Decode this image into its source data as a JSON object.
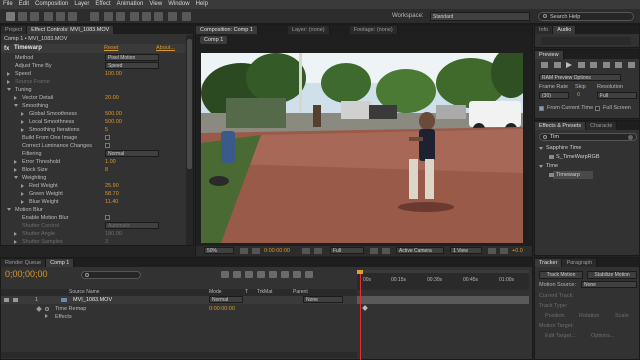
{
  "menu": [
    "File",
    "Edit",
    "Composition",
    "Layer",
    "Effect",
    "Animation",
    "View",
    "Window",
    "Help"
  ],
  "workspace": {
    "label": "Workspace:",
    "value": "Standard"
  },
  "search_help": {
    "placeholder": "Search Help"
  },
  "left_tabs": {
    "project": "Project",
    "effect_controls": "Effect Controls: MVI_1083.MOV"
  },
  "effect_controls": {
    "layer_path": "Comp 1 • MVI_1083.MOV",
    "effect_name": "Timewarp",
    "reset": "Reset",
    "about": "About...",
    "rows": [
      {
        "label": "Method",
        "value": "Pixel Motion",
        "kind": "dropdown"
      },
      {
        "label": "Adjust Time By",
        "value": "Speed",
        "kind": "dropdown"
      },
      {
        "label": "Speed",
        "value": "100.00",
        "kind": "value"
      },
      {
        "label": "Source Frame",
        "value": "",
        "kind": "dim"
      },
      {
        "label": "Tuning",
        "value": "",
        "kind": "group"
      },
      {
        "label": "Vector Detail",
        "value": "20.00",
        "kind": "value"
      },
      {
        "label": "Smoothing",
        "value": "",
        "kind": "group"
      },
      {
        "label": "Global Smoothness",
        "value": "500.00",
        "kind": "value"
      },
      {
        "label": "Local Smoothness",
        "value": "500.00",
        "kind": "value"
      },
      {
        "label": "Smoothing Iterations",
        "value": "5",
        "kind": "value"
      },
      {
        "label": "Build From One Image",
        "value": "",
        "kind": "checkbox"
      },
      {
        "label": "Correct Luminance Changes",
        "value": "",
        "kind": "checkbox"
      },
      {
        "label": "Filtering",
        "value": "Normal",
        "kind": "dropdown"
      },
      {
        "label": "Error Threshold",
        "value": "1.00",
        "kind": "value"
      },
      {
        "label": "Block Size",
        "value": "8",
        "kind": "value"
      },
      {
        "label": "Weighting",
        "value": "",
        "kind": "group"
      },
      {
        "label": "Red Weight",
        "value": "25.90",
        "kind": "value"
      },
      {
        "label": "Green Weight",
        "value": "58.70",
        "kind": "value"
      },
      {
        "label": "Blue Weight",
        "value": "11.40",
        "kind": "value"
      },
      {
        "label": "Motion Blur",
        "value": "",
        "kind": "group"
      },
      {
        "label": "Enable Motion Blur",
        "value": "",
        "kind": "checkbox"
      },
      {
        "label": "Shutter Control",
        "value": "Automatic",
        "kind": "dimdd"
      },
      {
        "label": "Shutter Angle",
        "value": "180.00",
        "kind": "dim"
      },
      {
        "label": "Shutter Samples",
        "value": "3",
        "kind": "dim"
      }
    ]
  },
  "comp_tabs": {
    "composition": "Composition: Comp 1",
    "layer": "Layer: (none)",
    "footage": "Footage: (none)"
  },
  "comp_breadcrumb": "Comp 1",
  "viewer": {
    "zoom": "50%",
    "timecode": "0:00:00:00",
    "resolution": "Full",
    "camera": "Active Camera",
    "views": "1 View",
    "offset": "+0.0"
  },
  "right_tabs": {
    "info": "Info",
    "audio": "Audio"
  },
  "preview": {
    "title": "Preview",
    "ram_options": "RAM Preview Options",
    "frame_rate_label": "Frame Rate",
    "skip_label": "Skip",
    "resolution_label": "Resolution",
    "frame_rate": "(30)",
    "skip": "0",
    "resolution": "Full",
    "from_current": "From Current Time",
    "full_screen": "Full Screen"
  },
  "effects_presets": {
    "tab1": "Effects & Presets",
    "tab2": "Characte",
    "search_value": "Tim",
    "items": [
      {
        "label": "Sapphire Time",
        "depth": 0,
        "open": true
      },
      {
        "label": "S_TimeWarpRGB",
        "depth": 1
      },
      {
        "label": "Time",
        "depth": 0,
        "open": true
      },
      {
        "label": "Timewarp",
        "depth": 1,
        "highlight": true
      }
    ]
  },
  "timeline": {
    "tabs": {
      "render_queue": "Render Queue",
      "comp": "Comp 1"
    },
    "timecode": "0;00;00;00",
    "columns": {
      "source": "Source Name",
      "mode": "Mode",
      "t": "T",
      "trkmat": "TrkMat",
      "parent": "Parent"
    },
    "layer": {
      "index": "1",
      "name": "MVI_1083.MOV",
      "mode": "Normal",
      "parent": "None"
    },
    "sub_rows": [
      {
        "label": "Time Remap",
        "value": "0:00:00:00"
      },
      {
        "label": "Effects",
        "value": ""
      }
    ],
    "ruler": [
      "00s",
      "00:15s",
      "00:30s",
      "00:45s",
      "01:00s"
    ]
  },
  "tracker": {
    "tabs": {
      "tracker": "Tracker",
      "paragraph": "Paragraph"
    },
    "track_motion": "Track Motion",
    "stabilize": "Stabilize Motion",
    "motion_source_label": "Motion Source:",
    "motion_source": "None",
    "rows": [
      "Current Track:",
      "Track Type:",
      "Position",
      "Rotation",
      "Scale",
      "Motion Target:",
      "Edit Target...",
      "Options..."
    ]
  }
}
